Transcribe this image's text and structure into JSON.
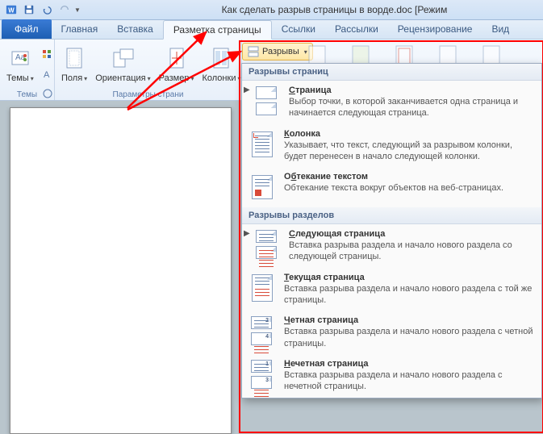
{
  "titlebar": {
    "title": "Как сделать разрыв страницы в ворде.doc [Режим"
  },
  "tabs": {
    "file": "Файл",
    "home": "Главная",
    "insert": "Вставка",
    "page_layout": "Разметка страницы",
    "references": "Ссылки",
    "mailings": "Рассылки",
    "review": "Рецензирование",
    "view": "Вид"
  },
  "ribbon": {
    "themes_label": "Темы",
    "themes_group": "Темы",
    "margins": "Поля",
    "orientation": "Ориентация",
    "size": "Размер",
    "columns": "Колонки",
    "page_setup_group": "Параметры страни",
    "breaks_button": "Разрывы"
  },
  "menu": {
    "section1": "Разрывы страниц",
    "section2": "Разрывы разделов",
    "items": [
      {
        "title": "Страница",
        "u": "С",
        "desc": "Выбор точки, в которой заканчивается одна страница и начинается следующая страница."
      },
      {
        "title": "Колонка",
        "u": "К",
        "desc": "Указывает, что текст, следующий за разрывом колонки, будет перенесен в начало следующей колонки."
      },
      {
        "title": "Обтекание текстом",
        "u": "б",
        "desc": "Обтекание текста вокруг объектов на веб-страницах."
      },
      {
        "title": "Следующая страница",
        "u": "С",
        "desc": "Вставка разрыва раздела и начало нового раздела со следующей страницы."
      },
      {
        "title": "Текущая страница",
        "u": "Т",
        "desc": "Вставка разрыва раздела и начало нового раздела с той же страницы."
      },
      {
        "title": "Четная страница",
        "u": "Ч",
        "desc": "Вставка разрыва раздела и начало нового раздела с четной страницы."
      },
      {
        "title": "Нечетная страница",
        "u": "Н",
        "desc": "Вставка разрыва раздела и начало нового раздела с нечетной страницы."
      }
    ]
  }
}
